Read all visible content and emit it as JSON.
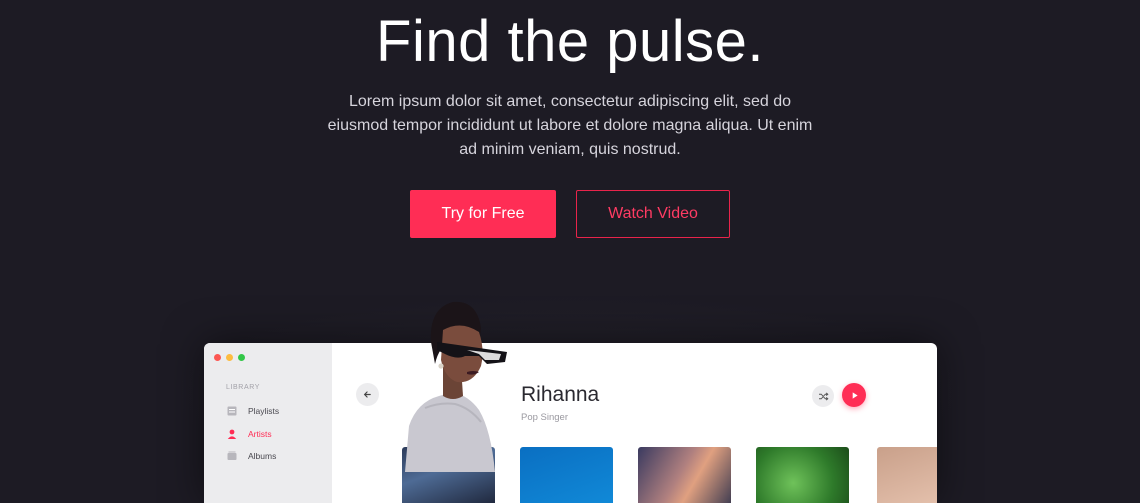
{
  "hero": {
    "title": "Find the pulse.",
    "description": "Lorem ipsum dolor sit amet, consectetur adipiscing elit, sed do eiusmod tempor incididunt ut labore et dolore magna aliqua. Ut enim ad minim veniam, quis nostrud.",
    "primary_cta": "Try for Free",
    "secondary_cta": "Watch Video"
  },
  "app": {
    "sidebar": {
      "section_label": "LIBRARY",
      "items": [
        {
          "label": "Playlists",
          "icon": "playlist-icon",
          "active": false
        },
        {
          "label": "Artists",
          "icon": "artist-icon",
          "active": true
        },
        {
          "label": "Albums",
          "icon": "album-icon",
          "active": false
        }
      ]
    },
    "artist": {
      "name": "Rihanna",
      "role": "Pop Singer"
    }
  },
  "colors": {
    "background": "#1d1b24",
    "accent": "#ff2d55"
  }
}
